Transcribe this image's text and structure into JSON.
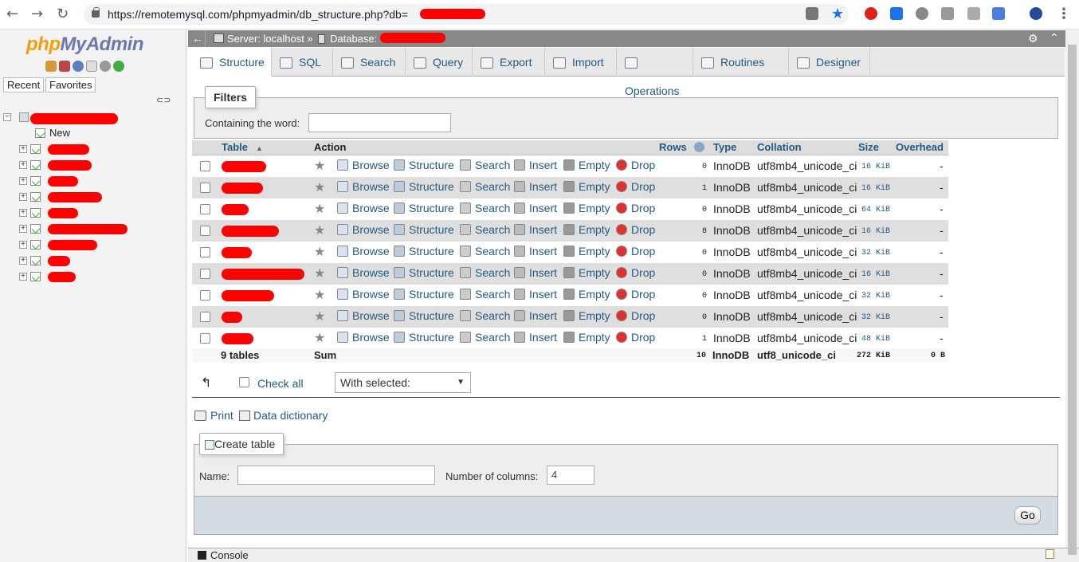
{
  "browser": {
    "url": "https://remotemysql.com/phpmyadmin/db_structure.php?db="
  },
  "nav": {
    "logo_php": "php",
    "logo_myadmin": "MyAdmin",
    "tabs": [
      "Recent",
      "Favorites"
    ],
    "new_label": "New"
  },
  "breadcrumb": {
    "server": "Server: localhost »",
    "database": "Database:"
  },
  "menu": {
    "tabs": [
      "Structure",
      "SQL",
      "Search",
      "Query",
      "Export",
      "Import",
      "Operations",
      "Routines",
      "Designer"
    ],
    "active": "Structure"
  },
  "filters": {
    "legend": "Filters",
    "label": "Containing the word:",
    "value": ""
  },
  "table": {
    "headers": {
      "table": "Table",
      "action": "Action",
      "rows": "Rows",
      "type": "Type",
      "collation": "Collation",
      "size": "Size",
      "overhead": "Overhead"
    },
    "actions": [
      "Browse",
      "Structure",
      "Search",
      "Insert",
      "Empty",
      "Drop"
    ],
    "rows": [
      {
        "rows": "0",
        "type": "InnoDB",
        "collation": "utf8mb4_unicode_ci",
        "size": "16 KiB",
        "overhead": "-"
      },
      {
        "rows": "1",
        "type": "InnoDB",
        "collation": "utf8mb4_unicode_ci",
        "size": "16 KiB",
        "overhead": "-"
      },
      {
        "rows": "0",
        "type": "InnoDB",
        "collation": "utf8mb4_unicode_ci",
        "size": "64 KiB",
        "overhead": "-"
      },
      {
        "rows": "8",
        "type": "InnoDB",
        "collation": "utf8mb4_unicode_ci",
        "size": "16 KiB",
        "overhead": "-"
      },
      {
        "rows": "0",
        "type": "InnoDB",
        "collation": "utf8mb4_unicode_ci",
        "size": "32 KiB",
        "overhead": "-"
      },
      {
        "rows": "0",
        "type": "InnoDB",
        "collation": "utf8mb4_unicode_ci",
        "size": "16 KiB",
        "overhead": "-"
      },
      {
        "rows": "0",
        "type": "InnoDB",
        "collation": "utf8mb4_unicode_ci",
        "size": "32 KiB",
        "overhead": "-"
      },
      {
        "rows": "0",
        "type": "InnoDB",
        "collation": "utf8mb4_unicode_ci",
        "size": "32 KiB",
        "overhead": "-"
      },
      {
        "rows": "1",
        "type": "InnoDB",
        "collation": "utf8mb4_unicode_ci",
        "size": "48 KiB",
        "overhead": "-"
      }
    ],
    "sum": {
      "tables": "9 tables",
      "label": "Sum",
      "rows": "10",
      "type": "InnoDB",
      "collation": "utf8_unicode_ci",
      "size": "272 KiB",
      "overhead": "0 B"
    }
  },
  "bulk": {
    "check_all": "Check all",
    "with_selected": "With selected:"
  },
  "links": {
    "print": "Print",
    "data_dictionary": "Data dictionary"
  },
  "create": {
    "legend": "Create table",
    "name_label": "Name:",
    "name_value": "",
    "columns_label": "Number of columns:",
    "columns_value": "4",
    "go": "Go"
  },
  "console": {
    "label": "Console"
  },
  "colors": {
    "link": "#235a81",
    "redaction": "#ff0000",
    "server_bar": "#888888"
  }
}
